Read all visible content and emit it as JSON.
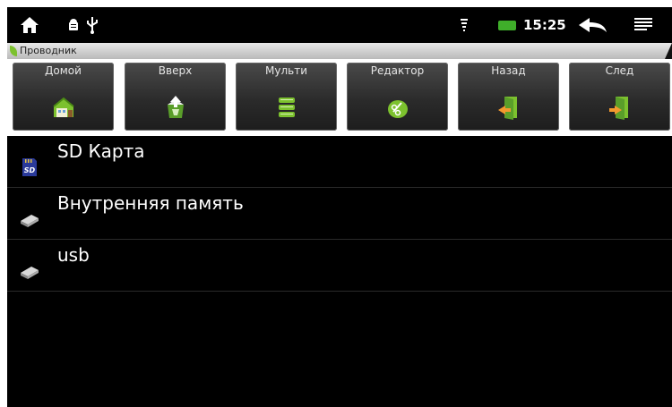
{
  "status_bar": {
    "time": "15:25",
    "icons": [
      "home-icon",
      "android-debug-icon",
      "usb-icon",
      "wifi-icon",
      "battery-icon",
      "back-icon",
      "menu-icon"
    ],
    "battery_color": "#3fae2a"
  },
  "app": {
    "title": "Проводник"
  },
  "toolbar": {
    "buttons": [
      {
        "label": "Домой",
        "icon": "home-folder-icon"
      },
      {
        "label": "Вверх",
        "icon": "up-folder-icon"
      },
      {
        "label": "Мульти",
        "icon": "multi-select-icon"
      },
      {
        "label": "Редактор",
        "icon": "editor-icon"
      },
      {
        "label": "Назад",
        "icon": "back-door-icon"
      },
      {
        "label": "След",
        "icon": "next-door-icon"
      }
    ]
  },
  "storage_list": [
    {
      "label": "SD Карта",
      "icon": "sd-card-icon"
    },
    {
      "label": "Внутренняя память",
      "icon": "drive-icon"
    },
    {
      "label": "usb",
      "icon": "drive-icon"
    }
  ],
  "colors": {
    "background": "#000000",
    "toolbar_background": "#ffffff",
    "accent_green": "#7cc12e"
  }
}
